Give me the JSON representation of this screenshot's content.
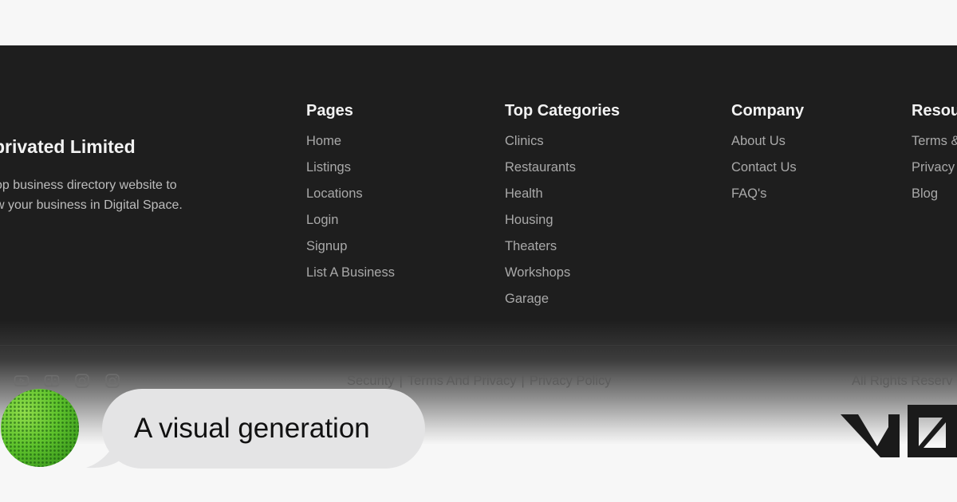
{
  "brand": {
    "name": "privated Limited",
    "description_lines": [
      "op business directory website to",
      "w your business in Digital Space."
    ]
  },
  "columns": {
    "pages": {
      "title": "Pages",
      "items": [
        "Home",
        "Listings",
        "Locations",
        "Login",
        "Signup",
        "List A Business"
      ]
    },
    "categories": {
      "title": "Top Categories",
      "items": [
        "Clinics",
        "Restaurants",
        "Health",
        "Housing",
        "Theaters",
        "Workshops",
        "Garage"
      ]
    },
    "company": {
      "title": "Company",
      "items": [
        "About Us",
        "Contact Us",
        "FAQ's"
      ]
    },
    "resources": {
      "title": "Resou",
      "items": [
        "Terms &",
        "Privacy",
        "Blog"
      ]
    }
  },
  "social_icons": [
    "youtube-icon",
    "film-icon",
    "instagram-icon",
    "instagram-icon"
  ],
  "legal": {
    "links": [
      "Security",
      "Terms And Privacy",
      "Privacy Policy"
    ],
    "separator": "|"
  },
  "rights": "All Rights Reserv",
  "chat": {
    "bubble_text": "A visual generation"
  },
  "colors": {
    "footer_bg": "#1e1e1e",
    "heading": "#f2f2f2",
    "link": "#a9a9a9",
    "avatar_green": "#5ec22c",
    "bubble_bg": "#e4e4e5"
  }
}
